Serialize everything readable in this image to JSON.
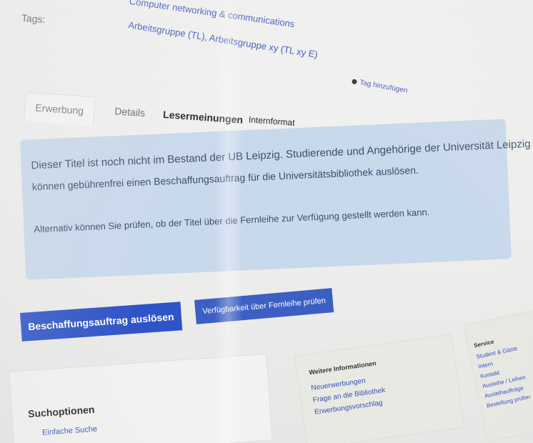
{
  "tags": {
    "label": "Tags:",
    "links": [
      "Computer networking & communications",
      "Arbeitsgruppe (TL), Arbeitsgruppe xy (TL xy E)"
    ],
    "add_link": "Tag hinzufügen"
  },
  "tabs": [
    {
      "label": "Erwerbung"
    },
    {
      "label": "Details"
    },
    {
      "label": "Lesermeinungen"
    },
    {
      "label": "Internformat"
    }
  ],
  "alert": {
    "line1": "Dieser Titel ist noch nicht im Bestand der UB Leipzig. Studierende und Angehörige der Universität Leipzig",
    "line2": "können gebührenfrei einen Beschaffungsauftrag für die Universitätsbibliothek auslösen.",
    "line3": "Alternativ können Sie prüfen, ob der Titel über die Fernleihe zur Verfügung gestellt werden kann."
  },
  "buttons": {
    "primary": "Beschaffungsauftrag auslösen",
    "secondary": "Verfügbarkeit über Fernleihe prüfen"
  },
  "search_options": {
    "title": "Suchoptionen",
    "sublink": "Einfache Suche"
  },
  "more_info": {
    "title": "Weitere Informationen",
    "items": [
      "Neuerwerbungen",
      "Frage an die Bibliothek",
      "Erwerbungsvorschlag"
    ]
  },
  "side_links": {
    "title": "Service",
    "items": [
      "Student & Gäste",
      "Intern",
      "Kontakt",
      "Ausleihe / Leihen",
      "Ausleihaufträge",
      "Bestellung prüfen"
    ]
  },
  "colors": {
    "link": "#3450b8",
    "alert_bg": "#c9d9ec",
    "primary_button": "#2f54c8"
  }
}
